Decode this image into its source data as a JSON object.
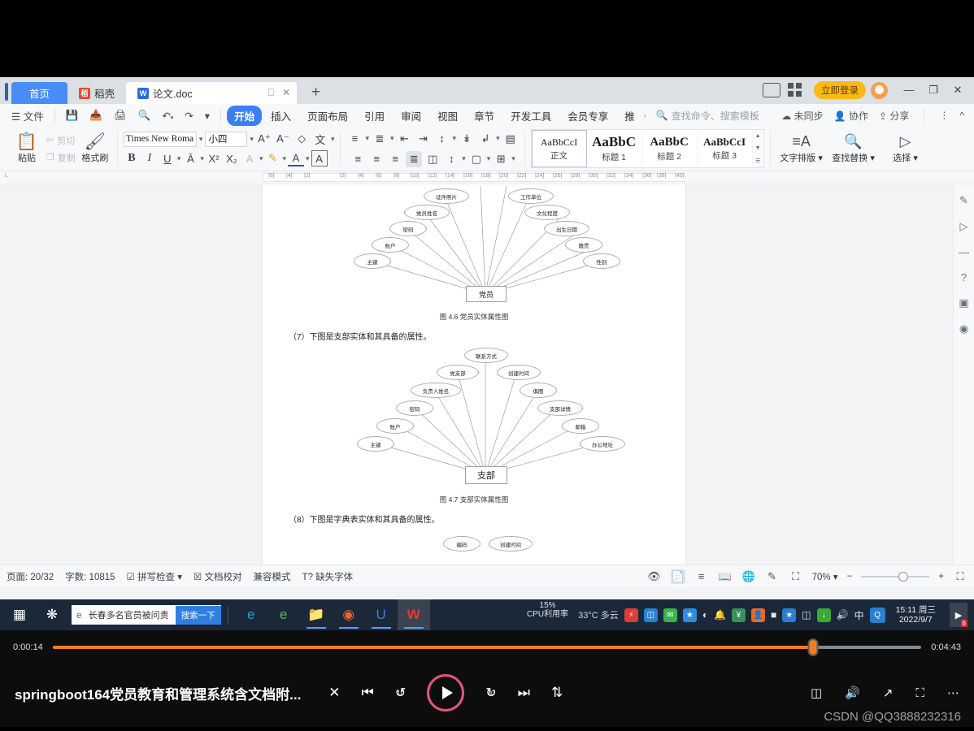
{
  "window": {
    "tabs": [
      {
        "label": "首页",
        "icon": "home-tab"
      },
      {
        "label": "稻壳",
        "icon": "daoke-icon"
      },
      {
        "label": "论文.doc",
        "icon": "wps-doc-icon"
      }
    ],
    "new_tab_label": "+",
    "login_label": "立即登录",
    "controls": {
      "minimize": "—",
      "maximize": "❐",
      "close": "✕"
    }
  },
  "menu": {
    "file_label": "文件",
    "quick_icons": [
      "save-icon",
      "save-as-icon",
      "print-icon",
      "print-preview-icon",
      "undo-icon",
      "redo-icon",
      "customize-icon"
    ],
    "tabs": [
      {
        "label": "开始",
        "selected": true
      },
      {
        "label": "插入",
        "selected": false
      },
      {
        "label": "页面布局",
        "selected": false
      },
      {
        "label": "引用",
        "selected": false
      },
      {
        "label": "审阅",
        "selected": false
      },
      {
        "label": "视图",
        "selected": false
      },
      {
        "label": "章节",
        "selected": false
      },
      {
        "label": "开发工具",
        "selected": false
      },
      {
        "label": "会员专享",
        "selected": false
      },
      {
        "label": "推",
        "selected": false
      }
    ],
    "search_placeholder": "查找命令、搜索模板",
    "right_items": [
      {
        "label": "未同步",
        "icon": "sync-icon"
      },
      {
        "label": "协作",
        "icon": "collaborate-icon"
      },
      {
        "label": "分享",
        "icon": "share-icon"
      }
    ]
  },
  "ribbon": {
    "paste_label": "粘贴",
    "cut_label": "剪切",
    "copy_label": "复制",
    "format_painter_label": "格式刷",
    "font_name": "Times New Roma",
    "font_size": "小四",
    "font_buttons": [
      "A+",
      "A-",
      "clear-format-icon",
      "pinyin-icon"
    ],
    "format_buttons": [
      "B",
      "I",
      "U",
      "strikethrough-icon",
      "superscript-icon",
      "subscript-icon",
      "character-border-icon",
      "highlight-icon",
      "font-color-icon",
      "text-box-icon"
    ],
    "paragraph_buttons": [
      "bullet-list-icon",
      "numbered-list-icon",
      "decrease-indent-icon",
      "increase-indent-icon",
      "sort-icon",
      "paragraph-mark-icon",
      "line-spacing-icon",
      "grid-icon"
    ],
    "align_buttons": [
      "align-left-icon",
      "align-center-icon",
      "align-right-icon",
      "justify-icon",
      "distribute-icon",
      "line-spacing2-icon",
      "shading-icon",
      "borders-icon"
    ],
    "styles": [
      {
        "preview": "AaBbCcI",
        "name": "正文",
        "selected": true
      },
      {
        "preview": "AaBbC",
        "name": "标题 1",
        "selected": false
      },
      {
        "preview": "AaBbC",
        "name": "标题 2",
        "selected": false
      },
      {
        "preview": "AaBbCcI",
        "name": "标题 3",
        "selected": false
      }
    ],
    "tools": [
      {
        "label": "文字排版",
        "icon": "text-layout-icon"
      },
      {
        "label": "查找替换",
        "icon": "search-icon"
      },
      {
        "label": "选择",
        "icon": "select-icon"
      }
    ]
  },
  "ruler": {
    "ticks": [
      "|6|",
      "|4|",
      "|2|",
      "|2|",
      "|4|",
      "|6|",
      "|8|",
      "|10|",
      "|12|",
      "|14|",
      "|16|",
      "|18|",
      "|20|",
      "|22|",
      "|24|",
      "|26|",
      "|28|",
      "|30|",
      "|32|",
      "|34|",
      "|36|",
      "|38|",
      "|40|"
    ]
  },
  "document": {
    "figure1": {
      "entity": "党员",
      "attributes": [
        "主键",
        "账户",
        "密码",
        "党员姓名",
        "证件照片",
        "工作单位",
        "文化程度",
        "出生日期",
        "籍贯",
        "性别"
      ],
      "caption": "图 4.6 党员实体属性图"
    },
    "paragraph1": "（7）下图是支部实体和其具备的属性。",
    "figure2": {
      "entity": "支部",
      "attributes": [
        "主键",
        "账户",
        "密码",
        "负责人姓名",
        "党支部",
        "联系方式",
        "创建时间",
        "俱图",
        "支部详情",
        "邮箱",
        "办公地址"
      ],
      "caption": "图 4.7 支部实体属性图"
    },
    "paragraph2": "（8）下图是字典表实体和其具备的属性。",
    "figure3": {
      "attributes": [
        "编码",
        "创建时间"
      ]
    }
  },
  "sidebar_right": {
    "icons": [
      "pen-icon",
      "cursor-icon",
      "divider-icon",
      "help-icon",
      "image-icon",
      "location-icon"
    ]
  },
  "statusbar": {
    "page_label": "页面: 20/32",
    "words_label": "字数: 10815",
    "spellcheck_label": "拼写检查",
    "proofread_label": "文档校对",
    "compat_label": "兼容模式",
    "missing_font_label": "缺失字体",
    "view_icons": [
      "eye-icon",
      "page-view-icon",
      "outline-view-icon",
      "reading-view-icon",
      "web-view-icon",
      "edit-icon",
      "fit-page-icon"
    ],
    "zoom_label": "70%",
    "zoom_minus": "−",
    "zoom_plus": "+",
    "fullscreen_icon": "fullscreen-icon"
  },
  "taskbar": {
    "start_icon": "windows-start-icon",
    "sogou_icon": "sogou-icon",
    "search_query": "长春多名官员被问责",
    "search_button": "搜索一下",
    "apps": [
      "ie-icon",
      "360-browser-icon",
      "file-explorer-icon",
      "browser-icon",
      "uc-icon",
      "wps-icon"
    ],
    "weather": "33°C 多云",
    "cpu_overlay_percent": "15%",
    "cpu_overlay_label": "CPU利用率",
    "tray_icons": [
      "thunder-icon",
      "usb-icon",
      "wechat-icon",
      "security-icon",
      "wifi-icon",
      "bell-icon",
      "money-icon",
      "qq-icon",
      "battery-icon",
      "bluetooth-icon",
      "disk-icon",
      "download-icon",
      "volume-icon"
    ],
    "ime_label": "中",
    "qq_label": "Q",
    "time": "15:11 周三",
    "date": "2022/9/7",
    "notification_count": "6"
  },
  "video": {
    "current_time": "0:00:14",
    "total_time": "0:04:43",
    "progress_percent": 87.5,
    "title": "springboot164党员教育和管理系统含文档附...",
    "controls": [
      "shuffle-icon",
      "previous-icon",
      "rewind-10-icon",
      "play-icon",
      "forward-30-icon",
      "next-icon",
      "repeat-off-icon"
    ],
    "rewind_seconds": "10",
    "forward_seconds": "30",
    "right_controls": [
      "subtitles-icon",
      "volume-icon",
      "expand-icon",
      "pip-icon",
      "more-icon"
    ],
    "watermark": "CSDN @QQ3888232316",
    "accent_color": "#f07d22"
  }
}
